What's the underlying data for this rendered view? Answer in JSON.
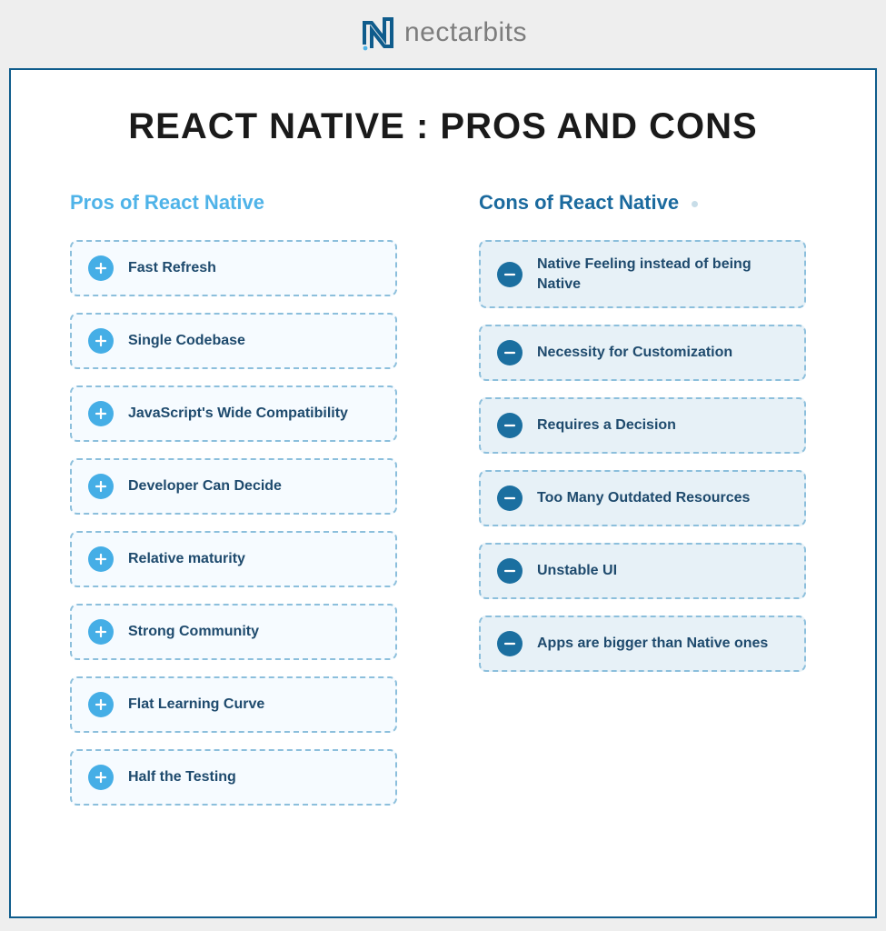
{
  "brand": {
    "name": "nectarbits"
  },
  "title": "REACT NATIVE : PROS AND CONS",
  "pros": {
    "heading": "Pros of React Native",
    "items": [
      "Fast Refresh",
      "Single Codebase",
      "JavaScript's Wide Compatibility",
      "Developer Can Decide",
      "Relative maturity",
      "Strong Community",
      "Flat Learning Curve",
      "Half the Testing"
    ]
  },
  "cons": {
    "heading": "Cons of React Native",
    "items": [
      "Native Feeling instead of being Native",
      "Necessity for Customization",
      "Requires a Decision",
      "Too Many Outdated Resources",
      "Unstable UI",
      "Apps are bigger than Native ones"
    ]
  },
  "colors": {
    "frame_border": "#0f5c8c",
    "pros_accent": "#4fb3e8",
    "cons_accent": "#1b6a9e",
    "plus_icon_bg": "#45aee6",
    "minus_icon_bg": "#1b6fa0",
    "item_text": "#1e4a6d"
  }
}
